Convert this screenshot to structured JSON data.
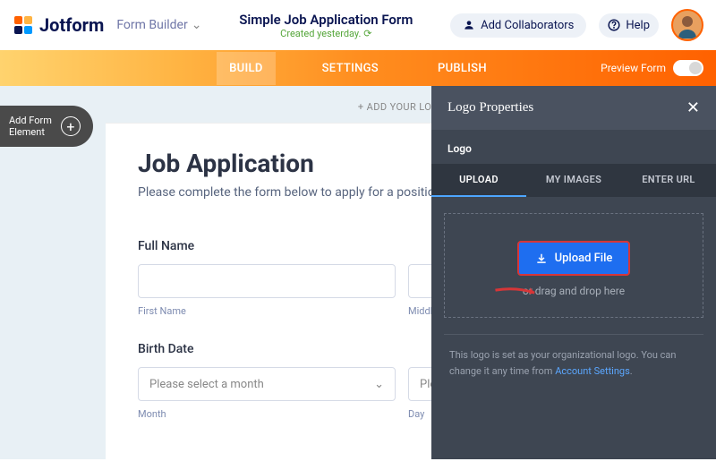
{
  "header": {
    "brand": "Jotform",
    "form_builder_label": "Form Builder",
    "form_title": "Simple Job Application Form",
    "created_text": "Created yesterday.",
    "add_collaborators": "Add Collaborators",
    "help": "Help"
  },
  "tabs": {
    "build": "BUILD",
    "settings": "SETTINGS",
    "publish": "PUBLISH"
  },
  "preview_label": "Preview Form",
  "add_element": "Add Form\nElement",
  "canvas": {
    "add_logo": "+ ADD YOUR LOGO",
    "title": "Job Application",
    "description": "Please complete the form below to apply for a position w",
    "full_name": "Full Name",
    "first_name": "First Name",
    "middle_name": "Middle Name",
    "birth_date": "Birth Date",
    "select_month": "Please select a month",
    "select_day": "Please select a day",
    "month": "Month",
    "day": "Day"
  },
  "panel": {
    "title": "Logo Properties",
    "section_label": "Logo",
    "tabs": {
      "upload": "UPLOAD",
      "my_images": "MY IMAGES",
      "enter_url": "ENTER URL"
    },
    "upload_btn": "Upload File",
    "drag_text": "or drag and drop here",
    "info_text": "This logo is set as your organizational logo. You can change it any time from ",
    "info_link": "Account Settings"
  }
}
